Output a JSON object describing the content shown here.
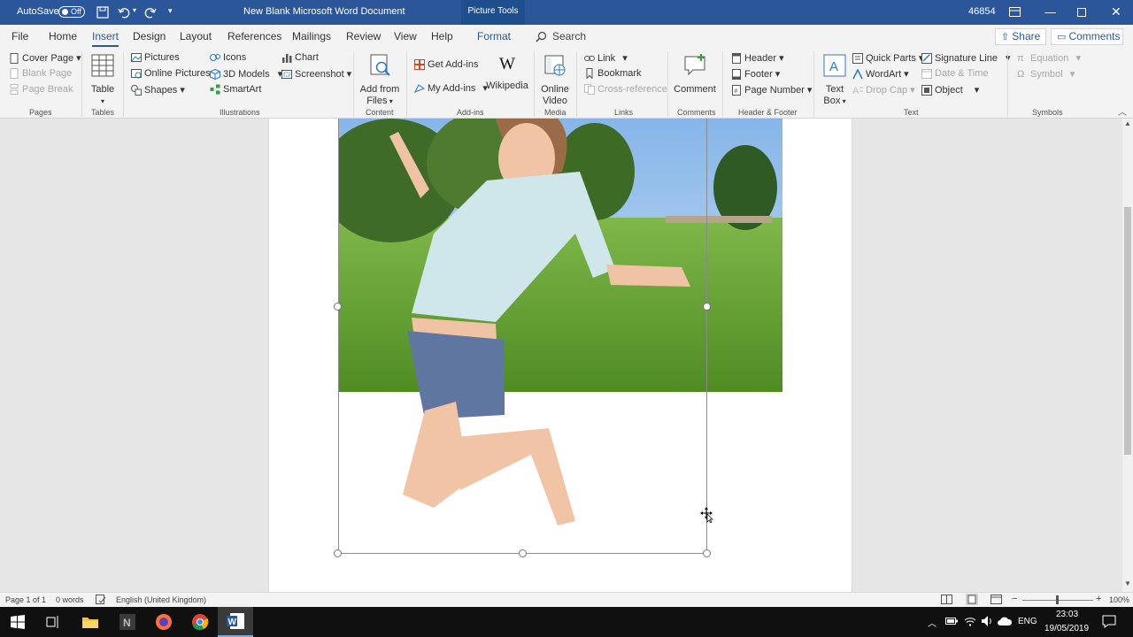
{
  "titlebar": {
    "autosave_label": "AutoSave",
    "autosave_state": "Off",
    "document_title": "New Blank Microsoft Word Document",
    "contextual_tab": "Picture Tools",
    "counter": "46854"
  },
  "tabs": [
    "File",
    "Home",
    "Insert",
    "Design",
    "Layout",
    "References",
    "Mailings",
    "Review",
    "View",
    "Help",
    "Format"
  ],
  "search_label": "Search",
  "share_label": "Share",
  "comments_label": "Comments",
  "ribbon": {
    "pages": {
      "items": [
        "Cover Page",
        "Blank Page",
        "Page Break"
      ],
      "label": "Pages"
    },
    "tables": {
      "item": "Table",
      "label": "Tables"
    },
    "illustrations": {
      "items": [
        "Pictures",
        "Online Pictures",
        "Shapes",
        "Icons",
        "3D Models",
        "SmartArt",
        "Chart",
        "Screenshot"
      ],
      "label": "Illustrations"
    },
    "content": {
      "item_line1": "Add from",
      "item_line2": "Files",
      "label": "Content"
    },
    "addins": {
      "items": [
        "Get Add-ins",
        "My Add-ins",
        "Wikipedia"
      ],
      "label": "Add-ins"
    },
    "media": {
      "item_line1": "Online",
      "item_line2": "Video",
      "label": "Media"
    },
    "links": {
      "items": [
        "Link",
        "Bookmark",
        "Cross-reference"
      ],
      "label": "Links"
    },
    "comments": {
      "item": "Comment",
      "label": "Comments"
    },
    "header_footer": {
      "items": [
        "Header",
        "Footer",
        "Page Number"
      ],
      "label": "Header & Footer"
    },
    "text": {
      "textbox_line1": "Text",
      "textbox_line2": "Box",
      "items": [
        "Quick Parts",
        "WordArt",
        "Drop Cap",
        "Signature Line",
        "Date & Time",
        "Object"
      ],
      "label": "Text"
    },
    "symbols": {
      "items": [
        "Equation",
        "Symbol"
      ],
      "label": "Symbols"
    }
  },
  "status": {
    "page": "Page 1 of 1",
    "words": "0 words",
    "language": "English (United Kingdom)",
    "zoom": "100%"
  },
  "taskbar": {
    "language": "ENG",
    "time": "23:03",
    "date": "19/05/2019"
  },
  "colors": {
    "word_blue": "#2b579a",
    "taskbar": "#101010"
  }
}
